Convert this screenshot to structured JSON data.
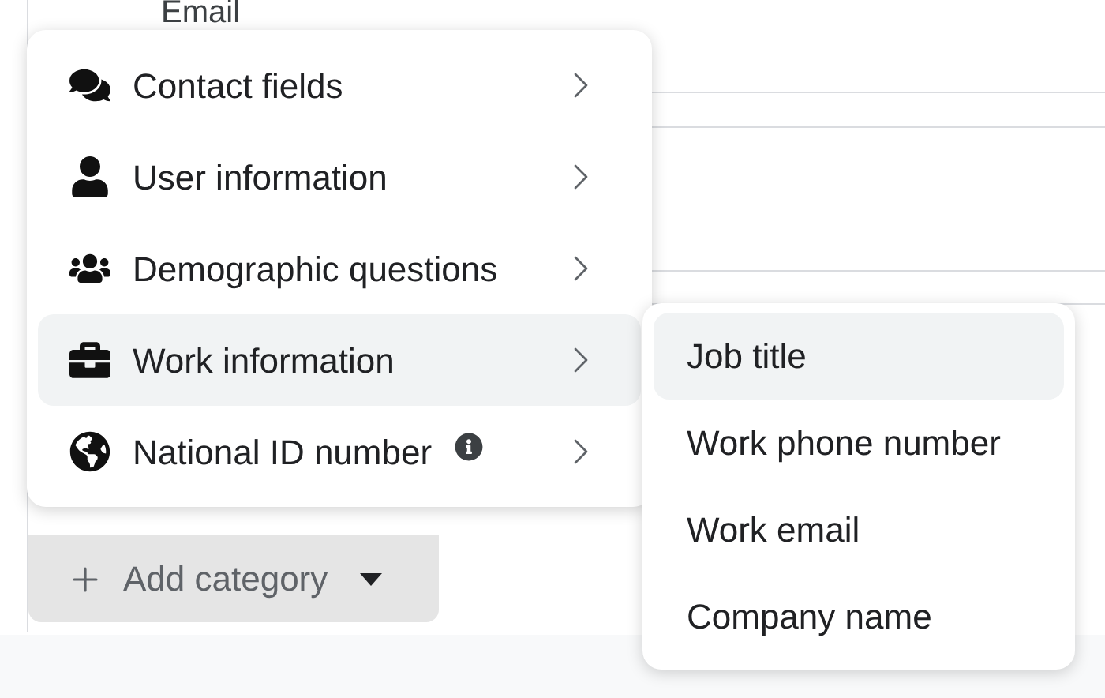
{
  "form": {
    "field_label": "Email"
  },
  "menu": {
    "items": [
      {
        "kind": "chat",
        "label": "Contact fields",
        "selected": false,
        "info": false
      },
      {
        "kind": "user",
        "label": "User information",
        "selected": false,
        "info": false
      },
      {
        "kind": "group",
        "label": "Demographic questions",
        "selected": false,
        "info": false
      },
      {
        "kind": "work",
        "label": "Work information",
        "selected": true,
        "info": false
      },
      {
        "kind": "globe",
        "label": "National ID number",
        "selected": false,
        "info": true
      }
    ]
  },
  "submenu": {
    "items": [
      {
        "label": "Job title",
        "selected": true
      },
      {
        "label": "Work phone number",
        "selected": false
      },
      {
        "label": "Work email",
        "selected": false
      },
      {
        "label": "Company name",
        "selected": false
      }
    ]
  },
  "add_button": {
    "label": "Add category"
  }
}
